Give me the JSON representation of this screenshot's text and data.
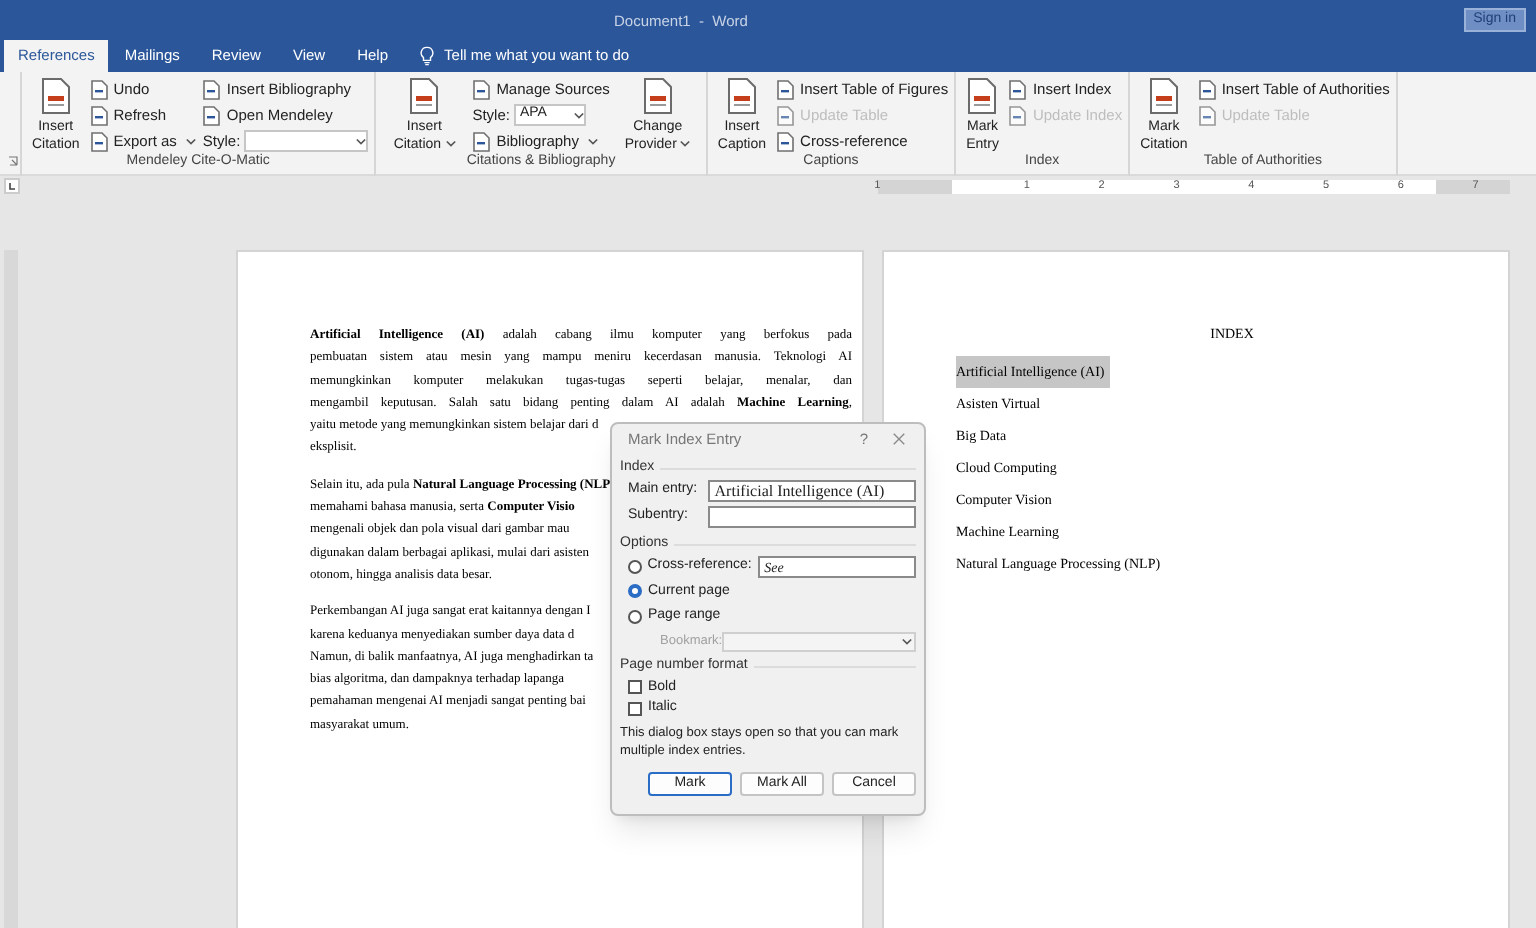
{
  "window": {
    "title": "Document1  -  Word",
    "sign_in": "Sign in"
  },
  "tabs": [
    {
      "label": "References",
      "selected": true
    },
    {
      "label": "Mailings",
      "selected": false
    },
    {
      "label": "Review",
      "selected": false
    },
    {
      "label": "View",
      "selected": false
    },
    {
      "label": "Help",
      "selected": false
    }
  ],
  "tell_me": "Tell me what you want to do",
  "ribbon_groups": [
    {
      "label": "Mendeley Cite-O-Matic",
      "columns": [
        {
          "kind": "large",
          "label": "Insert Citation",
          "has_menu": false
        },
        {
          "kind": "stack",
          "items": [
            {
              "kind": "small",
              "label": "Undo",
              "has_menu": false,
              "disabled": false
            },
            {
              "kind": "small",
              "label": "Refresh",
              "has_menu": false,
              "disabled": false
            },
            {
              "kind": "small",
              "label": "Export as",
              "has_menu": true,
              "disabled": false
            }
          ]
        },
        {
          "kind": "stack",
          "items": [
            {
              "kind": "small",
              "label": "Insert Bibliography",
              "has_menu": false,
              "disabled": false
            },
            {
              "kind": "small",
              "label": "Open Mendeley",
              "has_menu": false,
              "disabled": false
            },
            {
              "kind": "field",
              "label": "Style:",
              "has_menu": true,
              "disabled": false
            }
          ]
        }
      ]
    },
    {
      "label": "Citations & Bibliography",
      "columns": [
        {
          "kind": "large",
          "label": "Insert Citation",
          "has_menu": true
        },
        {
          "kind": "stack",
          "items": [
            {
              "kind": "small",
              "label": "Manage Sources",
              "has_menu": false,
              "disabled": false
            },
            {
              "kind": "field",
              "label": "Style:",
              "value": "APA",
              "has_menu": true,
              "disabled": false
            },
            {
              "kind": "small",
              "label": "Bibliography",
              "has_menu": true,
              "disabled": false
            }
          ]
        },
        {
          "kind": "large",
          "label": "Change Provider",
          "has_menu": true
        }
      ]
    },
    {
      "label": "Captions",
      "columns": [
        {
          "kind": "large",
          "label": "Insert Caption",
          "has_menu": false
        },
        {
          "kind": "stack",
          "items": [
            {
              "kind": "small",
              "label": "Insert Table of Figures",
              "has_menu": false,
              "disabled": false
            },
            {
              "kind": "small",
              "label": "Update Table",
              "has_menu": false,
              "disabled": true
            },
            {
              "kind": "small",
              "label": "Cross-reference",
              "has_menu": false,
              "disabled": false
            }
          ]
        }
      ]
    },
    {
      "label": "Index",
      "columns": [
        {
          "kind": "large",
          "label": "Mark Entry",
          "has_menu": false
        },
        {
          "kind": "stack",
          "items": [
            {
              "kind": "small",
              "label": "Insert Index",
              "has_menu": false,
              "disabled": false
            },
            {
              "kind": "small",
              "label": "Update Index",
              "has_menu": false,
              "disabled": true
            }
          ]
        }
      ]
    },
    {
      "label": "Table of Authorities",
      "columns": [
        {
          "kind": "large",
          "label": "Mark Citation",
          "has_menu": false
        },
        {
          "kind": "stack",
          "items": [
            {
              "kind": "small",
              "label": "Insert Table of Authorities",
              "has_menu": false,
              "disabled": false
            },
            {
              "kind": "small",
              "label": "Update Table",
              "has_menu": false,
              "disabled": true
            }
          ]
        }
      ]
    }
  ],
  "ruler": {
    "numbers": [
      "1",
      "1",
      "2",
      "3",
      "4",
      "5",
      "6",
      "7"
    ]
  },
  "left_page": {
    "paragraphs": [
      {
        "lines": [
          {
            "text": "**Artificial Intelligence (AI)** adalah cabang ilmu komputer yang berfokus pada",
            "kind": "justified"
          },
          {
            "text": "pembuatan sistem atau mesin yang mampu meniru kecerdasan manusia. Teknologi AI",
            "kind": "justified"
          },
          {
            "text": "memungkinkan komputer melakukan tugas-tugas seperti belajar, menalar, dan",
            "kind": "justified"
          },
          {
            "text": "mengambil keputusan. Salah satu bidang penting dalam AI adalah **Machine Learning**,",
            "kind": "justified"
          },
          {
            "text": "yaitu metode yang memungkinkan sistem belajar dari d",
            "kind": "ragged"
          },
          {
            "text": "eksplisit.",
            "kind": "ragged"
          }
        ]
      },
      {
        "lines": [
          {
            "text": "Selain itu, ada pula **Natural Language Processing (NLP**",
            "kind": "ragged"
          },
          {
            "text": "memahami bahasa manusia, serta **Computer Visio**",
            "kind": "ragged"
          },
          {
            "text": "mengenali objek dan pola visual dari gambar mau",
            "kind": "ragged"
          },
          {
            "text": "digunakan dalam berbagai aplikasi, mulai dari asisten",
            "kind": "ragged"
          },
          {
            "text": "otonom, hingga analisis data besar.",
            "kind": "ragged"
          }
        ]
      },
      {
        "lines": [
          {
            "text": "Perkembangan AI juga sangat erat kaitannya dengan I",
            "kind": "ragged"
          },
          {
            "text": "karena keduanya menyediakan sumber daya data d",
            "kind": "ragged"
          },
          {
            "text": "Namun, di balik manfaatnya, AI juga menghadirkan ta",
            "kind": "ragged"
          },
          {
            "text": "bias algoritma, dan dampaknya terhadap lapanga",
            "kind": "ragged"
          },
          {
            "text": "pemahaman mengenai AI menjadi sangat penting bai",
            "kind": "ragged"
          },
          {
            "text": "masyarakat umum.",
            "kind": "ragged"
          }
        ]
      }
    ]
  },
  "index_page": {
    "heading": "INDEX",
    "entries": [
      {
        "text": "Artificial Intelligence (AI)",
        "selected": true
      },
      {
        "text": "Asisten Virtual",
        "selected": false
      },
      {
        "text": "Big Data",
        "selected": false
      },
      {
        "text": "Cloud Computing",
        "selected": false
      },
      {
        "text": "Computer Vision",
        "selected": false
      },
      {
        "text": "Machine Learning",
        "selected": false
      },
      {
        "text": "Natural Language Processing (NLP)",
        "selected": false
      }
    ]
  },
  "dialog": {
    "title": "Mark Index Entry",
    "help": "?",
    "index_section": "Index",
    "main_entry": {
      "label": "Main entry:",
      "value": "Artificial Intelligence (AI)"
    },
    "subentry": {
      "label": "Subentry:"
    },
    "options_section": "Options",
    "options": [
      {
        "label": "Cross-reference:",
        "selected": false,
        "field": "See"
      },
      {
        "label": "Current page",
        "selected": true
      },
      {
        "label": "Page range",
        "selected": false
      }
    ],
    "bookmark": {
      "label": "Bookmark:",
      "disabled": true
    },
    "format_section": "Page number format",
    "format": [
      {
        "label": "Bold",
        "checked": false
      },
      {
        "label": "Italic",
        "checked": false
      }
    ],
    "note": "This dialog box stays open so that you can mark multiple index entries.",
    "buttons": [
      {
        "label": "Mark",
        "default": true
      },
      {
        "label": "Mark All",
        "default": false
      },
      {
        "label": "Cancel",
        "default": false
      }
    ]
  }
}
